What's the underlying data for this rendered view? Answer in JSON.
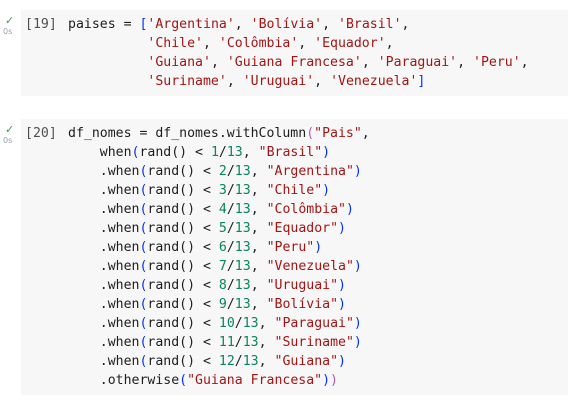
{
  "cells": [
    {
      "status": "✓",
      "time": "0s",
      "prompt": "[19]",
      "lines": [
        [
          {
            "t": "paises = ",
            "c": "punc"
          },
          {
            "t": "[",
            "c": "br2"
          },
          {
            "t": "'Argentina'",
            "c": "str"
          },
          {
            "t": ", ",
            "c": "punc"
          },
          {
            "t": "'Bolívia'",
            "c": "str"
          },
          {
            "t": ", ",
            "c": "punc"
          },
          {
            "t": "'Brasil'",
            "c": "str"
          },
          {
            "t": ",",
            "c": "punc"
          }
        ],
        [
          {
            "t": "          ",
            "c": "punc"
          },
          {
            "t": "'Chile'",
            "c": "str"
          },
          {
            "t": ", ",
            "c": "punc"
          },
          {
            "t": "'Colômbia'",
            "c": "str"
          },
          {
            "t": ", ",
            "c": "punc"
          },
          {
            "t": "'Equador'",
            "c": "str"
          },
          {
            "t": ",",
            "c": "punc"
          }
        ],
        [
          {
            "t": "          ",
            "c": "punc"
          },
          {
            "t": "'Guiana'",
            "c": "str"
          },
          {
            "t": ", ",
            "c": "punc"
          },
          {
            "t": "'Guiana Francesa'",
            "c": "str"
          },
          {
            "t": ", ",
            "c": "punc"
          },
          {
            "t": "'Paraguai'",
            "c": "str"
          },
          {
            "t": ", ",
            "c": "punc"
          },
          {
            "t": "'Peru'",
            "c": "str"
          },
          {
            "t": ",",
            "c": "punc"
          }
        ],
        [
          {
            "t": "          ",
            "c": "punc"
          },
          {
            "t": "'Suriname'",
            "c": "str"
          },
          {
            "t": ", ",
            "c": "punc"
          },
          {
            "t": "'Uruguai'",
            "c": "str"
          },
          {
            "t": ", ",
            "c": "punc"
          },
          {
            "t": "'Venezuela'",
            "c": "str"
          },
          {
            "t": "]",
            "c": "br2"
          }
        ]
      ]
    },
    {
      "status": "✓",
      "time": "0s",
      "prompt": "[20]",
      "lines": [
        [
          {
            "t": "df_nomes = df_nomes.withColumn",
            "c": "punc"
          },
          {
            "t": "(",
            "c": "br1"
          },
          {
            "t": "\"Pais\"",
            "c": "str"
          },
          {
            "t": ",",
            "c": "punc"
          }
        ],
        [
          {
            "t": "    when",
            "c": "punc"
          },
          {
            "t": "(",
            "c": "br2"
          },
          {
            "t": "rand() < ",
            "c": "punc"
          },
          {
            "t": "1",
            "c": "num"
          },
          {
            "t": "/",
            "c": "punc"
          },
          {
            "t": "13",
            "c": "num"
          },
          {
            "t": ", ",
            "c": "punc"
          },
          {
            "t": "\"Brasil\"",
            "c": "str"
          },
          {
            "t": ")",
            "c": "br2"
          }
        ],
        [
          {
            "t": "    .when",
            "c": "punc"
          },
          {
            "t": "(",
            "c": "br2"
          },
          {
            "t": "rand() < ",
            "c": "punc"
          },
          {
            "t": "2",
            "c": "num"
          },
          {
            "t": "/",
            "c": "punc"
          },
          {
            "t": "13",
            "c": "num"
          },
          {
            "t": ", ",
            "c": "punc"
          },
          {
            "t": "\"Argentina\"",
            "c": "str"
          },
          {
            "t": ")",
            "c": "br2"
          }
        ],
        [
          {
            "t": "    .when",
            "c": "punc"
          },
          {
            "t": "(",
            "c": "br2"
          },
          {
            "t": "rand() < ",
            "c": "punc"
          },
          {
            "t": "3",
            "c": "num"
          },
          {
            "t": "/",
            "c": "punc"
          },
          {
            "t": "13",
            "c": "num"
          },
          {
            "t": ", ",
            "c": "punc"
          },
          {
            "t": "\"Chile\"",
            "c": "str"
          },
          {
            "t": ")",
            "c": "br2"
          }
        ],
        [
          {
            "t": "    .when",
            "c": "punc"
          },
          {
            "t": "(",
            "c": "br2"
          },
          {
            "t": "rand() < ",
            "c": "punc"
          },
          {
            "t": "4",
            "c": "num"
          },
          {
            "t": "/",
            "c": "punc"
          },
          {
            "t": "13",
            "c": "num"
          },
          {
            "t": ", ",
            "c": "punc"
          },
          {
            "t": "\"Colômbia\"",
            "c": "str"
          },
          {
            "t": ")",
            "c": "br2"
          }
        ],
        [
          {
            "t": "    .when",
            "c": "punc"
          },
          {
            "t": "(",
            "c": "br2"
          },
          {
            "t": "rand() < ",
            "c": "punc"
          },
          {
            "t": "5",
            "c": "num"
          },
          {
            "t": "/",
            "c": "punc"
          },
          {
            "t": "13",
            "c": "num"
          },
          {
            "t": ", ",
            "c": "punc"
          },
          {
            "t": "\"Equador\"",
            "c": "str"
          },
          {
            "t": ")",
            "c": "br2"
          }
        ],
        [
          {
            "t": "    .when",
            "c": "punc"
          },
          {
            "t": "(",
            "c": "br2"
          },
          {
            "t": "rand() < ",
            "c": "punc"
          },
          {
            "t": "6",
            "c": "num"
          },
          {
            "t": "/",
            "c": "punc"
          },
          {
            "t": "13",
            "c": "num"
          },
          {
            "t": ", ",
            "c": "punc"
          },
          {
            "t": "\"Peru\"",
            "c": "str"
          },
          {
            "t": ")",
            "c": "br2"
          }
        ],
        [
          {
            "t": "    .when",
            "c": "punc"
          },
          {
            "t": "(",
            "c": "br2"
          },
          {
            "t": "rand() < ",
            "c": "punc"
          },
          {
            "t": "7",
            "c": "num"
          },
          {
            "t": "/",
            "c": "punc"
          },
          {
            "t": "13",
            "c": "num"
          },
          {
            "t": ", ",
            "c": "punc"
          },
          {
            "t": "\"Venezuela\"",
            "c": "str"
          },
          {
            "t": ")",
            "c": "br2"
          }
        ],
        [
          {
            "t": "    .when",
            "c": "punc"
          },
          {
            "t": "(",
            "c": "br2"
          },
          {
            "t": "rand() < ",
            "c": "punc"
          },
          {
            "t": "8",
            "c": "num"
          },
          {
            "t": "/",
            "c": "punc"
          },
          {
            "t": "13",
            "c": "num"
          },
          {
            "t": ", ",
            "c": "punc"
          },
          {
            "t": "\"Uruguai\"",
            "c": "str"
          },
          {
            "t": ")",
            "c": "br2"
          }
        ],
        [
          {
            "t": "    .when",
            "c": "punc"
          },
          {
            "t": "(",
            "c": "br2"
          },
          {
            "t": "rand() < ",
            "c": "punc"
          },
          {
            "t": "9",
            "c": "num"
          },
          {
            "t": "/",
            "c": "punc"
          },
          {
            "t": "13",
            "c": "num"
          },
          {
            "t": ", ",
            "c": "punc"
          },
          {
            "t": "\"Bolívia\"",
            "c": "str"
          },
          {
            "t": ")",
            "c": "br2"
          }
        ],
        [
          {
            "t": "    .when",
            "c": "punc"
          },
          {
            "t": "(",
            "c": "br2"
          },
          {
            "t": "rand() < ",
            "c": "punc"
          },
          {
            "t": "10",
            "c": "num"
          },
          {
            "t": "/",
            "c": "punc"
          },
          {
            "t": "13",
            "c": "num"
          },
          {
            "t": ", ",
            "c": "punc"
          },
          {
            "t": "\"Paraguai\"",
            "c": "str"
          },
          {
            "t": ")",
            "c": "br2"
          }
        ],
        [
          {
            "t": "    .when",
            "c": "punc"
          },
          {
            "t": "(",
            "c": "br2"
          },
          {
            "t": "rand() < ",
            "c": "punc"
          },
          {
            "t": "11",
            "c": "num"
          },
          {
            "t": "/",
            "c": "punc"
          },
          {
            "t": "13",
            "c": "num"
          },
          {
            "t": ", ",
            "c": "punc"
          },
          {
            "t": "\"Suriname\"",
            "c": "str"
          },
          {
            "t": ")",
            "c": "br2"
          }
        ],
        [
          {
            "t": "    .when",
            "c": "punc"
          },
          {
            "t": "(",
            "c": "br2"
          },
          {
            "t": "rand() < ",
            "c": "punc"
          },
          {
            "t": "12",
            "c": "num"
          },
          {
            "t": "/",
            "c": "punc"
          },
          {
            "t": "13",
            "c": "num"
          },
          {
            "t": ", ",
            "c": "punc"
          },
          {
            "t": "\"Guiana\"",
            "c": "str"
          },
          {
            "t": ")",
            "c": "br2"
          }
        ],
        [
          {
            "t": "    .otherwise",
            "c": "punc"
          },
          {
            "t": "(",
            "c": "br2"
          },
          {
            "t": "\"Guiana Francesa\"",
            "c": "str"
          },
          {
            "t": ")",
            "c": "br2"
          },
          {
            "t": ")",
            "c": "br1"
          }
        ]
      ]
    }
  ]
}
